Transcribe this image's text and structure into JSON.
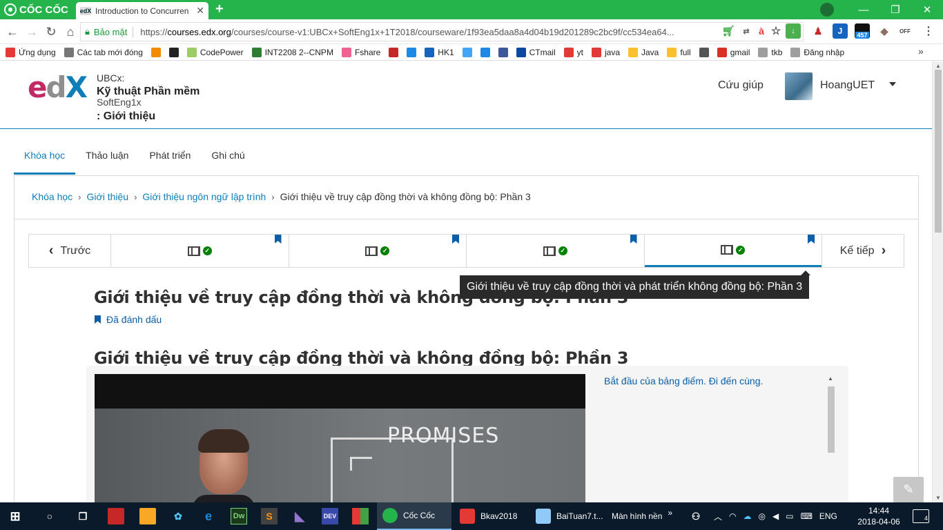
{
  "browser": {
    "brand": "CỐC CỐC",
    "tab_favicon": "edX",
    "tab_title": "Introduction to Concurren",
    "secure_label": "Bảo mật",
    "url_prefix": "https://",
    "url_host": "courses.edx.org",
    "url_path": "/courses/course-v1:UBCx+SoftEng1x+1T2018/courseware/1f93ea5daa8a4d04b19d201289c2bc9f/cc534ea64...",
    "ext_badge": "457"
  },
  "bookmarks": [
    {
      "label": "Ứng dụng",
      "color": "#e53935"
    },
    {
      "label": "Các tab mới đóng",
      "color": "#777777"
    },
    {
      "label": "",
      "color": "#f28b00"
    },
    {
      "label": "",
      "color": "#222222"
    },
    {
      "label": "CodePower",
      "color": "#9ccc65"
    },
    {
      "label": "INT2208 2--CNPM",
      "color": "#2e7d32"
    },
    {
      "label": "Fshare",
      "color": "#f06292"
    },
    {
      "label": "",
      "color": "#c62828"
    },
    {
      "label": "",
      "color": "#1e88e5"
    },
    {
      "label": "HK1",
      "color": "#1565c0"
    },
    {
      "label": "",
      "color": "#42a5f5"
    },
    {
      "label": "",
      "color": "#1e88e5"
    },
    {
      "label": "",
      "color": "#3b5998"
    },
    {
      "label": "CTmail",
      "color": "#0d47a1"
    },
    {
      "label": "yt",
      "color": "#e53935"
    },
    {
      "label": "java",
      "color": "#e53935"
    },
    {
      "label": "Java",
      "color": "#fbc02d"
    },
    {
      "label": "full",
      "color": "#fbc02d"
    },
    {
      "label": "",
      "color": "#555555"
    },
    {
      "label": "gmail",
      "color": "#d93025"
    },
    {
      "label": "tkb",
      "color": "#9e9e9e"
    },
    {
      "label": "Đăng nhập",
      "color": "#9e9e9e"
    }
  ],
  "header": {
    "org": "UBCx:",
    "course_name": "Kỹ thuật Phần mềm",
    "course_code": "SoftEng1x",
    "section": ": Giới thiệu",
    "help": "Cứu giúp",
    "username": "HoangUET"
  },
  "course_tabs": [
    "Khóa học",
    "Thảo luận",
    "Phát triển",
    "Ghi chú"
  ],
  "breadcrumb": {
    "items": [
      "Khóa học",
      "Giới thiệu",
      "Giới thiệu ngôn ngữ lập trình"
    ],
    "current": "Giới thiệu về truy cập đồng thời và không đồng bộ: Phần 3"
  },
  "sequence": {
    "prev": "Trước",
    "next": "Kế tiếp"
  },
  "unit": {
    "title": "Giới thiệu về truy cập đồng thời và không đồng bộ: Phần 3",
    "bookmarked": "Đã đánh dấu",
    "tooltip": "Giới thiệu về truy cập đồng thời và phát triển không đồng bộ: Phần 3",
    "video_title": "Giới thiệu về truy cập đồng thời và không đồng bộ: Phần 3",
    "video_board_text": "PROMISES",
    "transcript_link": "Bắt đầu của bảng điểm. Đi đến cùng."
  },
  "taskbar": {
    "apps": [
      "Cốc Cốc",
      "Bkav2018",
      "BaiTuan7.t...",
      "Màn hình nền"
    ],
    "lang": "ENG",
    "time": "14:44",
    "date": "2018-04-06",
    "notifications": "4"
  }
}
